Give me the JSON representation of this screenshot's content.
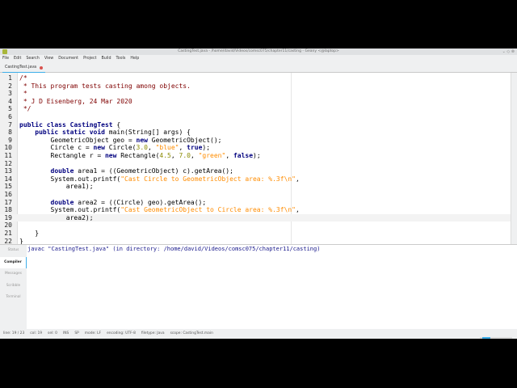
{
  "window": {
    "title": "CastingTest.java - /home/david/Videos/comsc075/chapter11/casting - Geany <@laptop>",
    "controls": "⌄ ◇ ⊗"
  },
  "menu": [
    "File",
    "Edit",
    "Search",
    "View",
    "Document",
    "Project",
    "Build",
    "Tools",
    "Help"
  ],
  "tab": {
    "label": "CastingTest.java"
  },
  "editor": {
    "current_line": 19,
    "lines": [
      [
        [
          "c",
          "/*"
        ]
      ],
      [
        [
          "c",
          " * This program tests casting among objects."
        ]
      ],
      [
        [
          "c",
          " *"
        ]
      ],
      [
        [
          "c",
          " * J D Eisenberg, 24 Mar 2020"
        ]
      ],
      [
        [
          "c",
          " */"
        ]
      ],
      [],
      [
        [
          "k",
          "public class "
        ],
        [
          "k",
          "CastingTest"
        ],
        [
          "p",
          " {"
        ]
      ],
      [
        [
          "p",
          "    "
        ],
        [
          "k",
          "public static void "
        ],
        [
          "p",
          "main(String[] args) {"
        ]
      ],
      [
        [
          "p",
          "        GeometricObject geo = "
        ],
        [
          "k",
          "new "
        ],
        [
          "p",
          "GeometricObject();"
        ]
      ],
      [
        [
          "p",
          "        Circle c = "
        ],
        [
          "k",
          "new "
        ],
        [
          "p",
          "Circle("
        ],
        [
          "n",
          "3.0"
        ],
        [
          "p",
          ", "
        ],
        [
          "s",
          "\"blue\""
        ],
        [
          "p",
          ", "
        ],
        [
          "k",
          "true"
        ],
        [
          "p",
          ");"
        ]
      ],
      [
        [
          "p",
          "        Rectangle r = "
        ],
        [
          "k",
          "new "
        ],
        [
          "p",
          "Rectangle("
        ],
        [
          "n",
          "4.5"
        ],
        [
          "p",
          ", "
        ],
        [
          "n",
          "7.0"
        ],
        [
          "p",
          ", "
        ],
        [
          "s",
          "\"green\""
        ],
        [
          "p",
          ", "
        ],
        [
          "k",
          "false"
        ],
        [
          "p",
          ");"
        ]
      ],
      [],
      [
        [
          "p",
          "        "
        ],
        [
          "k",
          "double "
        ],
        [
          "p",
          "area1 = ((GeometricObject) c).getArea();"
        ]
      ],
      [
        [
          "p",
          "        System.out.printf("
        ],
        [
          "s",
          "\"Cast Circle to GeometricObject area: %.3f\\n\""
        ],
        [
          "p",
          ","
        ]
      ],
      [
        [
          "p",
          "            area1);"
        ]
      ],
      [],
      [
        [
          "p",
          "        "
        ],
        [
          "k",
          "double "
        ],
        [
          "p",
          "area2 = ((Circle) geo).getArea();"
        ]
      ],
      [
        [
          "p",
          "        System.out.printf("
        ],
        [
          "s",
          "\"Cast GeometricObject to Circle area: %.3f\\n\""
        ],
        [
          "p",
          ","
        ]
      ],
      [
        [
          "p",
          "            area2);"
        ]
      ],
      [],
      [
        [
          "p",
          "    }"
        ]
      ],
      [
        [
          "p",
          "}"
        ]
      ]
    ]
  },
  "panel": {
    "tabs": [
      "Status",
      "Compiler",
      "Messages",
      "Scribble",
      "Terminal"
    ],
    "active": "Compiler",
    "output": "javac \"CastingTest.java\" (in directory: /home/david/Videos/comsc075/chapter11/casting)"
  },
  "status": {
    "line": "line: 19 / 23",
    "col": "col: 19",
    "sel": "sel: 0",
    "ins": "INS",
    "sp": "SP",
    "mode": "mode: LF",
    "encoding": "encoding: UTF-8",
    "filetype": "filetype: Java",
    "scope": "scope: CastingTest.main"
  }
}
